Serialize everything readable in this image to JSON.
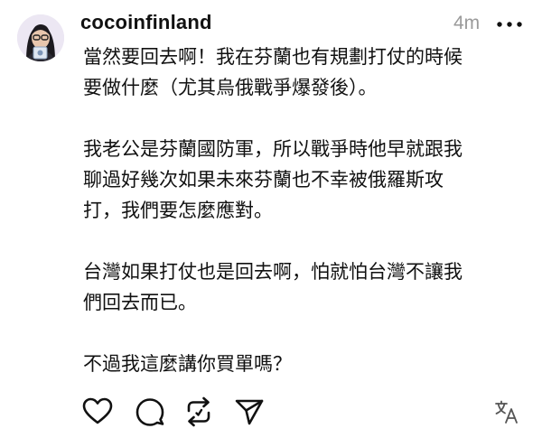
{
  "post": {
    "username": "cocoinfinland",
    "timestamp": "4m",
    "paragraphs": [
      "當然要回去啊！我在芬蘭也有規劃打仗的時候\n要做什麼（尤其烏俄戰爭爆發後）。",
      "我老公是芬蘭國防軍，所以戰爭時他早就跟我\n聊過好幾次如果未來芬蘭也不幸被俄羅斯攻\n打，我們要怎麼應對。",
      "台灣如果打仗也是回去啊，怕就怕台灣不讓我\n們回去而已。",
      "不過我這麼講你買單嗎？"
    ]
  },
  "icons": {
    "more": "more-horizontal-icon",
    "like": "heart-icon",
    "reply": "comment-bubble-icon",
    "repost": "repost-icon",
    "share": "send-paper-plane-icon",
    "translate": "translate-icon"
  },
  "colors": {
    "text": "#111111",
    "muted": "#9a9a9a",
    "background": "#ffffff"
  }
}
